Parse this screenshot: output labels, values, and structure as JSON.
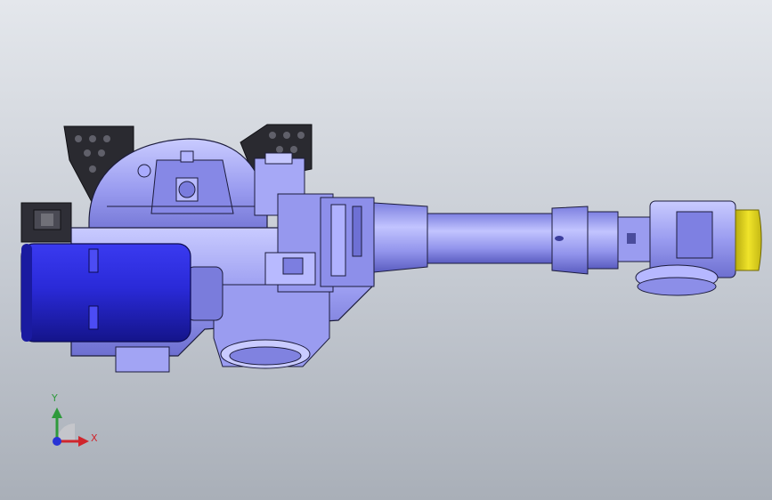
{
  "viewport": {
    "background_top": "#e4e7ec",
    "background_bottom": "#a9afb8"
  },
  "model": {
    "icon": "robot-arm-cad-model",
    "colors": {
      "body": "#9a9cf0",
      "body_shadow": "#6d6fd0",
      "body_highlight": "#c9cbff",
      "motor": "#2a2ad8",
      "motor_dark": "#1a1aa0",
      "bracket": "#2a2a30",
      "flange": "#e3d61a",
      "outline": "#1c1c3c"
    }
  },
  "triad": {
    "icon": "coordinate-triad-icon",
    "y_label": "Y",
    "x_label": "X",
    "y_color": "#2f9a3c",
    "x_color": "#d0252c",
    "z_color": "#2833d6"
  }
}
